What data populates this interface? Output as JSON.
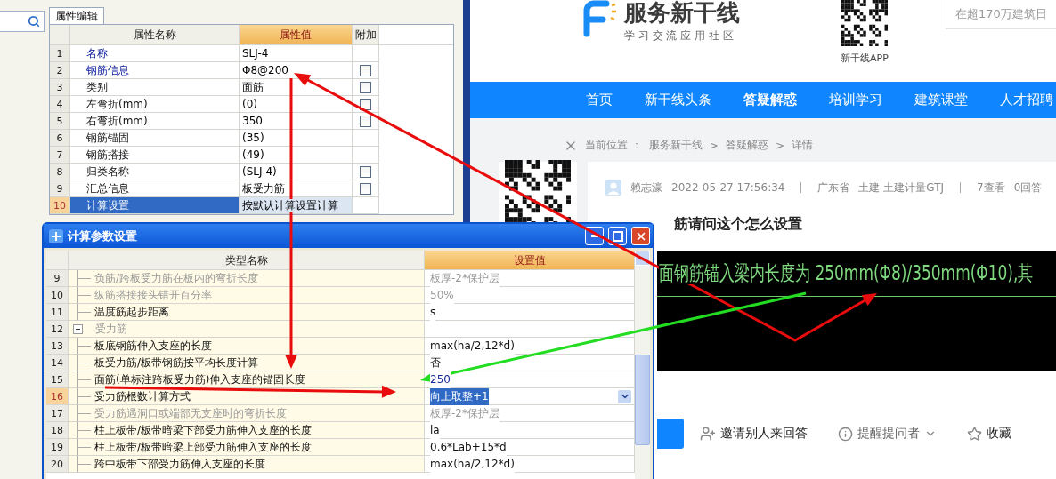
{
  "property_panel": {
    "tab": "属性编辑",
    "columns": [
      "属性名称",
      "属性值",
      "附加"
    ],
    "rows": [
      {
        "num": "1",
        "name": "名称",
        "value": "SLJ-4",
        "highlighted": true,
        "selected": false
      },
      {
        "num": "2",
        "name": "钢筋信息",
        "value": "Φ8@200",
        "highlighted": true,
        "selected": false,
        "checked": false
      },
      {
        "num": "3",
        "name": "类别",
        "value": "面筋",
        "highlighted": false,
        "selected": false,
        "checked": false
      },
      {
        "num": "4",
        "name": "左弯折(mm)",
        "value": "(0)",
        "highlighted": false,
        "selected": false,
        "checked": false
      },
      {
        "num": "5",
        "name": "右弯折(mm)",
        "value": "350",
        "highlighted": false,
        "selected": false,
        "checked": false
      },
      {
        "num": "6",
        "name": "钢筋锚固",
        "value": "(35)",
        "highlighted": false,
        "selected": false
      },
      {
        "num": "7",
        "name": "钢筋搭接",
        "value": "(49)",
        "highlighted": false,
        "selected": false
      },
      {
        "num": "8",
        "name": "归类名称",
        "value": "(SLJ-4)",
        "highlighted": false,
        "selected": false,
        "checked": false
      },
      {
        "num": "9",
        "name": "汇总信息",
        "value": "板受力筋",
        "highlighted": false,
        "selected": false,
        "checked": false
      },
      {
        "num": "10",
        "name": "计算设置",
        "value": "按默认计算设置计算",
        "highlighted": false,
        "selected": true
      }
    ]
  },
  "dialog": {
    "title": "计算参数设置",
    "columns": [
      "类型名称",
      "设置值"
    ],
    "rows": [
      {
        "num": "9",
        "name": "负筋/跨板受力筋在板内的弯折长度",
        "value": "板厚-2*保护层",
        "disabled": true,
        "selected": false,
        "modified": false
      },
      {
        "num": "10",
        "name": "纵筋搭接接头错开百分率",
        "value": "50%",
        "disabled": true,
        "selected": false,
        "modified": false
      },
      {
        "num": "11",
        "name": "温度筋起步距离",
        "value": "s",
        "disabled": false,
        "selected": false,
        "modified": false
      },
      {
        "num": "12",
        "name": "受力筋",
        "disabled": true,
        "selected": false,
        "expanded": true,
        "children": [
          {
            "num": "13",
            "name": "板底钢筋伸入支座的长度",
            "value": "max(ha/2,12*d)",
            "disabled": false,
            "selected": false,
            "modified": false
          },
          {
            "num": "14",
            "name": "板受力筋/板带钢筋按平均长度计算",
            "value": "否",
            "disabled": false,
            "selected": false,
            "modified": false
          },
          {
            "num": "15",
            "name": "面筋(单标注跨板受力筋)伸入支座的锚固长度",
            "value": "250",
            "disabled": false,
            "selected": false,
            "modified": true
          },
          {
            "num": "16",
            "name": "受力筋根数计算方式",
            "value": "向上取整+1",
            "disabled": false,
            "selected": true,
            "modified": false
          },
          {
            "num": "17",
            "name": "受力筋遇洞口或端部无支座时的弯折长度",
            "value": "板厚-2*保护层",
            "disabled": true,
            "selected": false,
            "modified": false
          },
          {
            "num": "18",
            "name": "柱上板带/板带暗梁下部受力筋伸入支座的长度",
            "value": "la",
            "disabled": false,
            "selected": false,
            "modified": false
          },
          {
            "num": "19",
            "name": "柱上板带/板带暗梁上部受力筋伸入支座的长度",
            "value": "0.6*Lab+15*d",
            "disabled": false,
            "selected": false,
            "modified": false
          },
          {
            "num": "20",
            "name": "跨中板带下部受力筋伸入支座的长度",
            "value": "max(ha/2,12*d)",
            "disabled": false,
            "selected": false,
            "modified": false
          }
        ]
      }
    ]
  },
  "web": {
    "logo": {
      "title": "服务新干线",
      "subtitle": "学 习 交 流 应 用 社 区"
    },
    "app_qr_label": "新干线APP",
    "search": {
      "placeholder": "在超170万建筑日"
    },
    "nav": [
      {
        "label": "首页",
        "selected": false
      },
      {
        "label": "新干线头条",
        "selected": false
      },
      {
        "label": "答疑解惑",
        "selected": true
      },
      {
        "label": "培训学习",
        "selected": false
      },
      {
        "label": "建筑课堂",
        "selected": false
      },
      {
        "label": "人才招聘",
        "selected": false
      }
    ],
    "breadcrumb": {
      "label": "当前位置 ：",
      "crumbs": [
        "服务新干线",
        "答疑解惑",
        "详情"
      ],
      "separators": [
        ">",
        ">"
      ]
    },
    "question": {
      "author": "赖志濠",
      "time": "2022-05-27 17:56:34",
      "location": "广东省",
      "tags": "土建 土建计量GTJ",
      "views": "7查看",
      "answers": "0回答",
      "title": "筋请问这个怎么设置",
      "image_text": "面钢筋锚入梁内长度为 250mm(Φ8)/350mm(Φ10),其"
    },
    "actions": [
      {
        "kind": "invite",
        "label": "邀请别人来回答"
      },
      {
        "kind": "remind",
        "label": "提醒提问者"
      },
      {
        "kind": "favorite",
        "label": "收藏"
      }
    ]
  }
}
